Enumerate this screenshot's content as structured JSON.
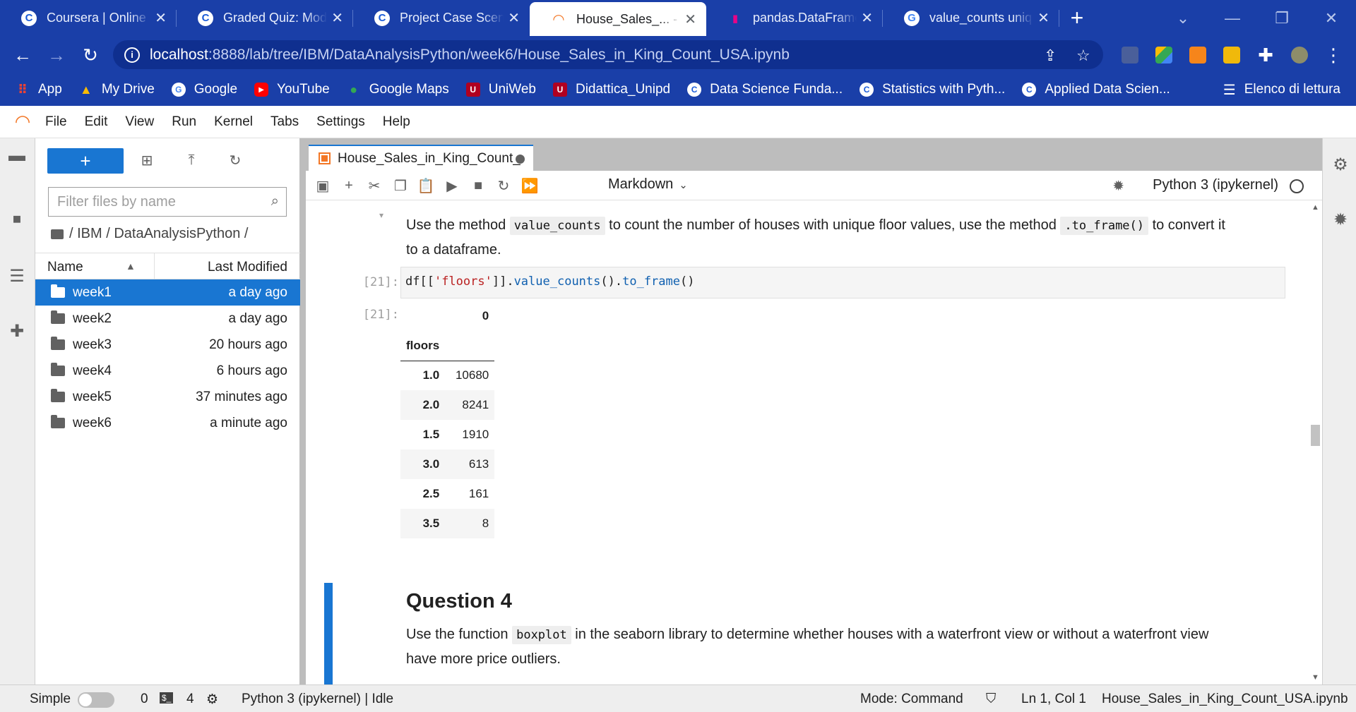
{
  "browser": {
    "tabs": [
      {
        "label": "Coursera | Online C",
        "icon": "coursera-icon",
        "active": false
      },
      {
        "label": "Graded Quiz: Mode",
        "icon": "coursera-icon",
        "active": false
      },
      {
        "label": "Project Case Scenar",
        "icon": "coursera-icon",
        "active": false
      },
      {
        "label": "House_Sales_... - Ju",
        "icon": "jupyter-icon",
        "active": true
      },
      {
        "label": "pandas.DataFrame.",
        "icon": "pandas-icon",
        "active": false
      },
      {
        "label": "value_counts uniqu",
        "icon": "google-icon",
        "active": false
      }
    ],
    "url_host": "localhost",
    "url_path": ":8888/lab/tree/IBM/DataAnalysisPython/week6/House_Sales_in_King_Count_USA.ipynb",
    "bookmarks": [
      {
        "label": "App",
        "icon": "apps-grid-icon",
        "color": "#ea4335"
      },
      {
        "label": "My Drive",
        "icon": "drive-icon",
        "color": "#fbbc04"
      },
      {
        "label": "Google",
        "icon": "google-icon",
        "color": "#ffffff"
      },
      {
        "label": "YouTube",
        "icon": "youtube-icon",
        "color": "#ff0000"
      },
      {
        "label": "Google Maps",
        "icon": "maps-pin-icon",
        "color": "#34a853"
      },
      {
        "label": "UniWeb",
        "icon": "unipd-icon",
        "color": "#b00020"
      },
      {
        "label": "Didattica_Unipd",
        "icon": "unipd-icon",
        "color": "#b00020"
      },
      {
        "label": "Data Science Funda...",
        "icon": "coursera-icon",
        "color": "#ffffff"
      },
      {
        "label": "Statistics with Pyth...",
        "icon": "coursera-icon",
        "color": "#ffffff"
      },
      {
        "label": "Applied Data Scien...",
        "icon": "coursera-icon",
        "color": "#ffffff"
      }
    ],
    "reading_list": "Elenco di lettura"
  },
  "menu": [
    "File",
    "Edit",
    "View",
    "Run",
    "Kernel",
    "Tabs",
    "Settings",
    "Help"
  ],
  "filebrowser": {
    "filter_placeholder": "Filter files by name",
    "breadcrumb": "/ IBM / DataAnalysisPython /",
    "col_name": "Name",
    "col_modified": "Last Modified",
    "rows": [
      {
        "name": "week1",
        "modified": "a day ago",
        "selected": true
      },
      {
        "name": "week2",
        "modified": "a day ago",
        "selected": false
      },
      {
        "name": "week3",
        "modified": "20 hours ago",
        "selected": false
      },
      {
        "name": "week4",
        "modified": "6 hours ago",
        "selected": false
      },
      {
        "name": "week5",
        "modified": "37 minutes ago",
        "selected": false
      },
      {
        "name": "week6",
        "modified": "a minute ago",
        "selected": false
      }
    ]
  },
  "notebook": {
    "tab_title": "House_Sales_in_King_Count_",
    "cell_type": "Markdown",
    "kernel": "Python 3 (ipykernel)",
    "md1": {
      "t1": "Use the method ",
      "c1": "value_counts",
      "t2": " to count the number of houses with unique floor values, use the method ",
      "c2": ".to_frame()",
      "t3": " to convert it to a dataframe."
    },
    "in_prompt": "[21]:",
    "out_prompt": "[21]:",
    "code": {
      "p1": "df[[",
      "s1": "'floors'",
      "p2": "]].",
      "f1": "value_counts",
      "p3": "().",
      "f2": "to_frame",
      "p4": "()"
    },
    "output": {
      "column": "0",
      "index_name": "floors",
      "rows": [
        {
          "index": "1.0",
          "value": "10680"
        },
        {
          "index": "2.0",
          "value": "8241"
        },
        {
          "index": "1.5",
          "value": "1910"
        },
        {
          "index": "3.0",
          "value": "613"
        },
        {
          "index": "2.5",
          "value": "161"
        },
        {
          "index": "3.5",
          "value": "8"
        }
      ]
    },
    "q4_title": "Question 4",
    "md2": {
      "t1": "Use the function ",
      "c1": "boxplot",
      "t2": " in the seaborn library to determine whether houses with a waterfront view or without a waterfront view have more price outliers."
    }
  },
  "statusbar": {
    "mode_label": "Simple",
    "terminals": "0",
    "kernels": "4",
    "kernel_status": "Python 3 (ipykernel) | Idle",
    "mode": "Mode: Command",
    "cursor": "Ln 1, Col 1",
    "filename": "House_Sales_in_King_Count_USA.ipynb"
  }
}
